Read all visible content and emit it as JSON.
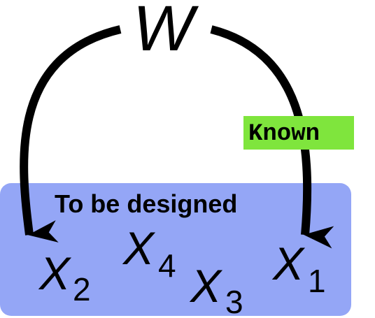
{
  "colors": {
    "design_box": "#94a6f6",
    "known_tag": "#7fe53d",
    "arrow": "#000000",
    "text": "#000000"
  },
  "nodes": {
    "w": {
      "label": "W"
    },
    "x2": {
      "label": "X",
      "subscript": "2"
    },
    "x4": {
      "label": "X",
      "subscript": "4"
    },
    "x3": {
      "label": "X",
      "subscript": "3"
    },
    "x1": {
      "label": "X",
      "subscript": "1"
    }
  },
  "design_box": {
    "label": "To be designed"
  },
  "known_tag": {
    "label": "Known"
  },
  "edges": [
    {
      "from": "W",
      "to": "X2"
    },
    {
      "from": "W",
      "to": "X1",
      "tag": "Known"
    }
  ]
}
